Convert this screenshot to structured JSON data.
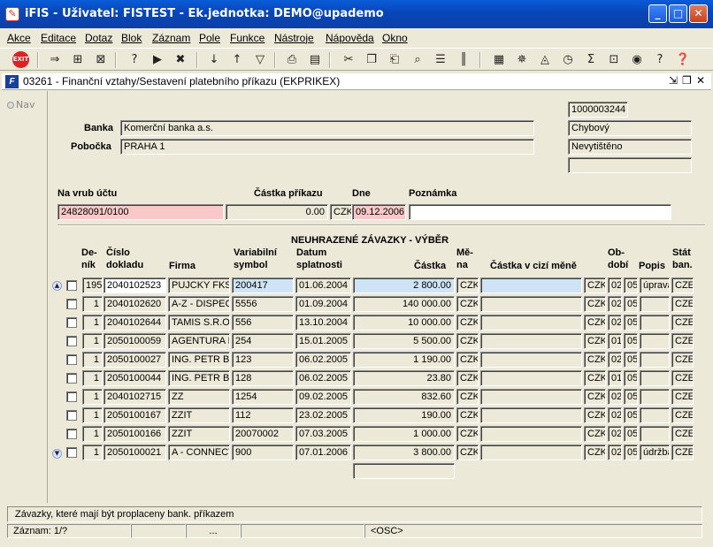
{
  "window": {
    "title": "iFIS - Uživatel: FISTEST - Ek.jednotka: DEMO@upademo",
    "app_icon": "ifis-app-icon"
  },
  "menu": [
    "Akce",
    "Editace",
    "Dotaz",
    "Blok",
    "Záznam",
    "Pole",
    "Funkce",
    "Nástroje",
    "Nápověda",
    "Okno"
  ],
  "toolbar": {
    "exit_label": "EXIT"
  },
  "form": {
    "title": "03261 - Finanční vztahy/Sestavení platebního příkazu (EKPRIKEX)",
    "nav_label": "Nav"
  },
  "header": {
    "banka_label": "Banka",
    "banka_value": "Komerční banka a.s.",
    "pobocka_label": "Pobočka",
    "pobocka_value": "PRAHA 1",
    "doc_number": "1000003244",
    "status1": "Chybový",
    "status2": "Nevytištěno",
    "status3": ""
  },
  "payment": {
    "na_vrub_label": "Na vrub účtu",
    "na_vrub_value": "24828091/0100",
    "castka_label": "Částka příkazu",
    "castka_value": "0.00",
    "mena_value": "CZK",
    "dne_label": "Dne",
    "dne_value": "09.12.2006",
    "poznamka_label": "Poznámka",
    "poznamka_value": ""
  },
  "table": {
    "section_title": "NEUHRAZENÉ ZÁVAZKY - VÝBĚR",
    "columns": {
      "denik": "De-\nník",
      "cislo": "Číslo\ndokladu",
      "firma": "Firma",
      "vs": "Variabilní\nsymbol",
      "datum": "Datum\nsplatnosti",
      "castka": "Částka",
      "mena": "Mě-\nna",
      "cizi": "Částka v cizí měně",
      "obdobi": "Ob-\ndobí",
      "popis": "Popis",
      "stat": "Stát\nban."
    },
    "rows": [
      {
        "denik": "195",
        "cislo": "2040102523",
        "firma": "PUJCKY FKSP",
        "vs": "200417",
        "datum": "01.06.2004",
        "castka": "2 800.00",
        "mena": "CZK",
        "cizi": "",
        "cmena": "CZK",
        "ob1": "02",
        "ob2": "05",
        "popis": "úprava",
        "stat": "CZE"
      },
      {
        "denik": "1",
        "cislo": "2040102620",
        "firma": "A-Z - DISPECINK",
        "vs": "5556",
        "datum": "01.09.2004",
        "castka": "140 000.00",
        "mena": "CZK",
        "cizi": "",
        "cmena": "CZK",
        "ob1": "02",
        "ob2": "05",
        "popis": "",
        "stat": "CZE"
      },
      {
        "denik": "1",
        "cislo": "2040102644",
        "firma": "TAMIS S.R.O.",
        "vs": "556",
        "datum": "13.10.2004",
        "castka": "10 000.00",
        "mena": "CZK",
        "cizi": "",
        "cmena": "CZK",
        "ob1": "02",
        "ob2": "05",
        "popis": "",
        "stat": "CZE"
      },
      {
        "denik": "1",
        "cislo": "2050100059",
        "firma": "AGENTURA MAB",
        "vs": "254",
        "datum": "15.01.2005",
        "castka": "5 500.00",
        "mena": "CZK",
        "cizi": "",
        "cmena": "CZK",
        "ob1": "01",
        "ob2": "05",
        "popis": "",
        "stat": "CZE"
      },
      {
        "denik": "1",
        "cislo": "2050100027",
        "firma": "ING. PETR BRNO",
        "vs": "123",
        "datum": "06.02.2005",
        "castka": "1 190.00",
        "mena": "CZK",
        "cizi": "",
        "cmena": "CZK",
        "ob1": "02",
        "ob2": "05",
        "popis": "",
        "stat": "CZE"
      },
      {
        "denik": "1",
        "cislo": "2050100044",
        "firma": "ING. PETR BRNO",
        "vs": "128",
        "datum": "06.02.2005",
        "castka": "23.80",
        "mena": "CZK",
        "cizi": "",
        "cmena": "CZK",
        "ob1": "01",
        "ob2": "05",
        "popis": "",
        "stat": "CZE"
      },
      {
        "denik": "1",
        "cislo": "2040102715",
        "firma": "ZZ",
        "vs": "1254",
        "datum": "09.02.2005",
        "castka": "832.60",
        "mena": "CZK",
        "cizi": "",
        "cmena": "CZK",
        "ob1": "02",
        "ob2": "05",
        "popis": "",
        "stat": "CZE"
      },
      {
        "denik": "1",
        "cislo": "2050100167",
        "firma": "ZZIT",
        "vs": "112",
        "datum": "23.02.2005",
        "castka": "190.00",
        "mena": "CZK",
        "cizi": "",
        "cmena": "CZK",
        "ob1": "02",
        "ob2": "05",
        "popis": "",
        "stat": "CZE"
      },
      {
        "denik": "1",
        "cislo": "2050100166",
        "firma": "ZZIT",
        "vs": "20070002",
        "datum": "07.03.2005",
        "castka": "1 000.00",
        "mena": "CZK",
        "cizi": "",
        "cmena": "CZK",
        "ob1": "02",
        "ob2": "05",
        "popis": "",
        "stat": "CZE"
      },
      {
        "denik": "1",
        "cislo": "2050100021",
        "firma": "A - CONNECT",
        "vs": "900",
        "datum": "07.01.2006",
        "castka": "3 800.00",
        "mena": "CZK",
        "cizi": "",
        "cmena": "CZK",
        "ob1": "02",
        "ob2": "05",
        "popis": "údržba",
        "stat": "CZE"
      }
    ],
    "total": ""
  },
  "status": {
    "message": "Závazky, které mají být proplaceny bank. příkazem",
    "record": "Záznam: 1/?",
    "ellipsis": "...",
    "mode": "<OSC>"
  }
}
